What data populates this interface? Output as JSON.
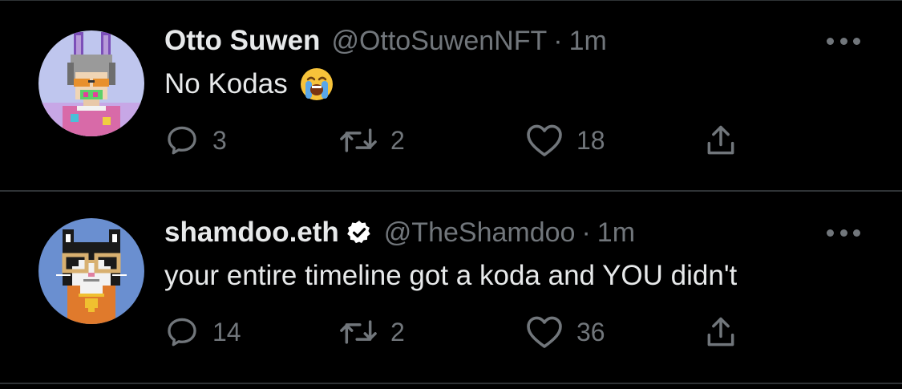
{
  "tweets": [
    {
      "display_name": "Otto Suwen",
      "handle": "@OttoSuwenNFT",
      "separator": "·",
      "time": "1m",
      "verified": false,
      "text": "No Kodas",
      "emoji": "loudly-crying-face",
      "reply_count": "3",
      "retweet_count": "2",
      "like_count": "18",
      "avatar_icon": "pixel-bunny-character-avatar"
    },
    {
      "display_name": "shamdoo.eth",
      "handle": "@TheShamdoo",
      "separator": "·",
      "time": "1m",
      "verified": true,
      "text": "your entire timeline got a koda and YOU didn't",
      "emoji": "",
      "reply_count": "14",
      "retweet_count": "2",
      "like_count": "36",
      "avatar_icon": "pixel-cat-with-glasses-avatar"
    }
  ],
  "colors": {
    "background": "#000000",
    "primary_text": "#e7e9ea",
    "secondary_text": "#71767b",
    "divider": "#2f3336",
    "verified_badge": "#ffffff"
  }
}
